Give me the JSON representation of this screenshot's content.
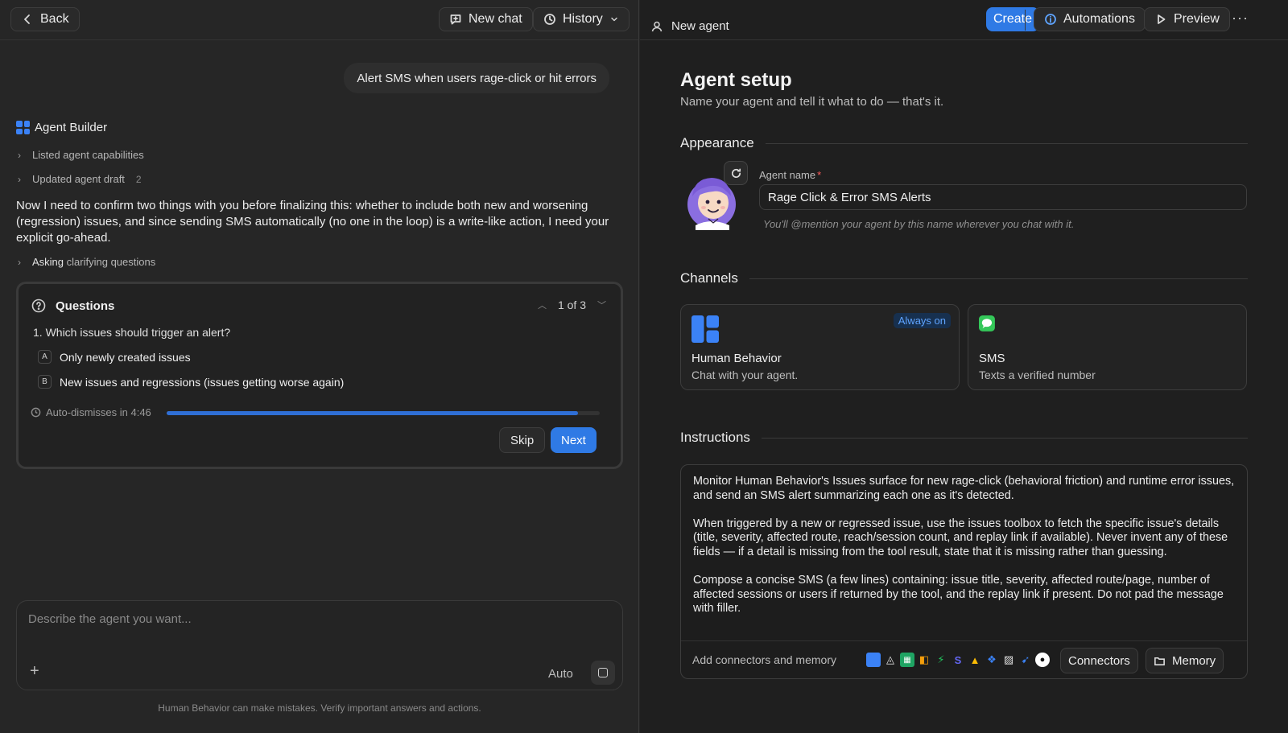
{
  "left_header": {
    "back_label": "Back",
    "new_chat_label": "New chat",
    "history_label": "History"
  },
  "chat": {
    "user_message": "Alert SMS when users rage-click or hit errors",
    "assistant_name": "Agent Builder",
    "steps": [
      {
        "label": "Listed agent capabilities"
      },
      {
        "label": "Updated agent draft",
        "count": "2"
      }
    ],
    "message": "Now I need to confirm two things with you before finalizing this: whether to include both new and worsening (regression) issues, and since sending SMS automatically (no one in the loop) is a write-like action, I need your explicit go-ahead.",
    "asking_step": {
      "bold": "Asking",
      "rest": "clarifying questions"
    }
  },
  "questions": {
    "title": "Questions",
    "pager": "1 of 3",
    "question": "1. Which issues should trigger an alert?",
    "options": [
      {
        "key": "A",
        "label": "Only newly created issues"
      },
      {
        "key": "B",
        "label": "New issues and regressions (issues getting worse again)"
      }
    ],
    "auto_dismiss": "Auto-dismisses in 4:46",
    "progress": 0.95,
    "skip_label": "Skip",
    "next_label": "Next"
  },
  "composer": {
    "placeholder": "Describe the agent you want...",
    "mode": "Auto",
    "disclaimer": "Human Behavior can make mistakes. Verify important answers and actions."
  },
  "right_header": {
    "agent_label": "New agent",
    "create_label": "Create",
    "automations_label": "Automations",
    "preview_label": "Preview"
  },
  "setup": {
    "title": "Agent setup",
    "subtitle": "Name your agent and tell it what to do — that's it.",
    "appearance_heading": "Appearance",
    "name_label": "Agent name",
    "name_required": "*",
    "name_value": "Rage Click & Error SMS Alerts",
    "name_hint": "You'll @mention your agent by this name wherever you chat with it.",
    "channels_heading": "Channels",
    "channels": [
      {
        "name": "Human Behavior",
        "desc": "Chat with your agent.",
        "badge": "Always on",
        "icon": "human-behavior-logo"
      },
      {
        "name": "SMS",
        "desc": "Texts a verified number",
        "icon": "sms-icon"
      }
    ],
    "instructions_heading": "Instructions",
    "instructions": [
      "Monitor Human Behavior's Issues surface for new rage-click (behavioral friction) and runtime error issues, and send an SMS alert summarizing each one as it's detected.",
      "When triggered by a new or regressed issue, use the issues toolbox to fetch the specific issue's details (title, severity, affected route, reach/session count, and replay link if available). Never invent any of these fields — if a detail is missing from the tool result, state that it is missing rather than guessing.",
      "Compose a concise SMS (a few lines) containing: issue title, severity, affected route/page, number of affected sessions or users if returned by the tool, and the replay link if present. Do not pad the message with filler."
    ],
    "add_connectors_label": "Add connectors and memory",
    "connectors_label": "Connectors",
    "memory_label": "Memory"
  },
  "colors": {
    "accent": "#2f7ae5",
    "background_left": "#262626",
    "background_right": "#1f1f1f",
    "badge_text": "#5fa4ff",
    "sms_green": "#34c759"
  }
}
